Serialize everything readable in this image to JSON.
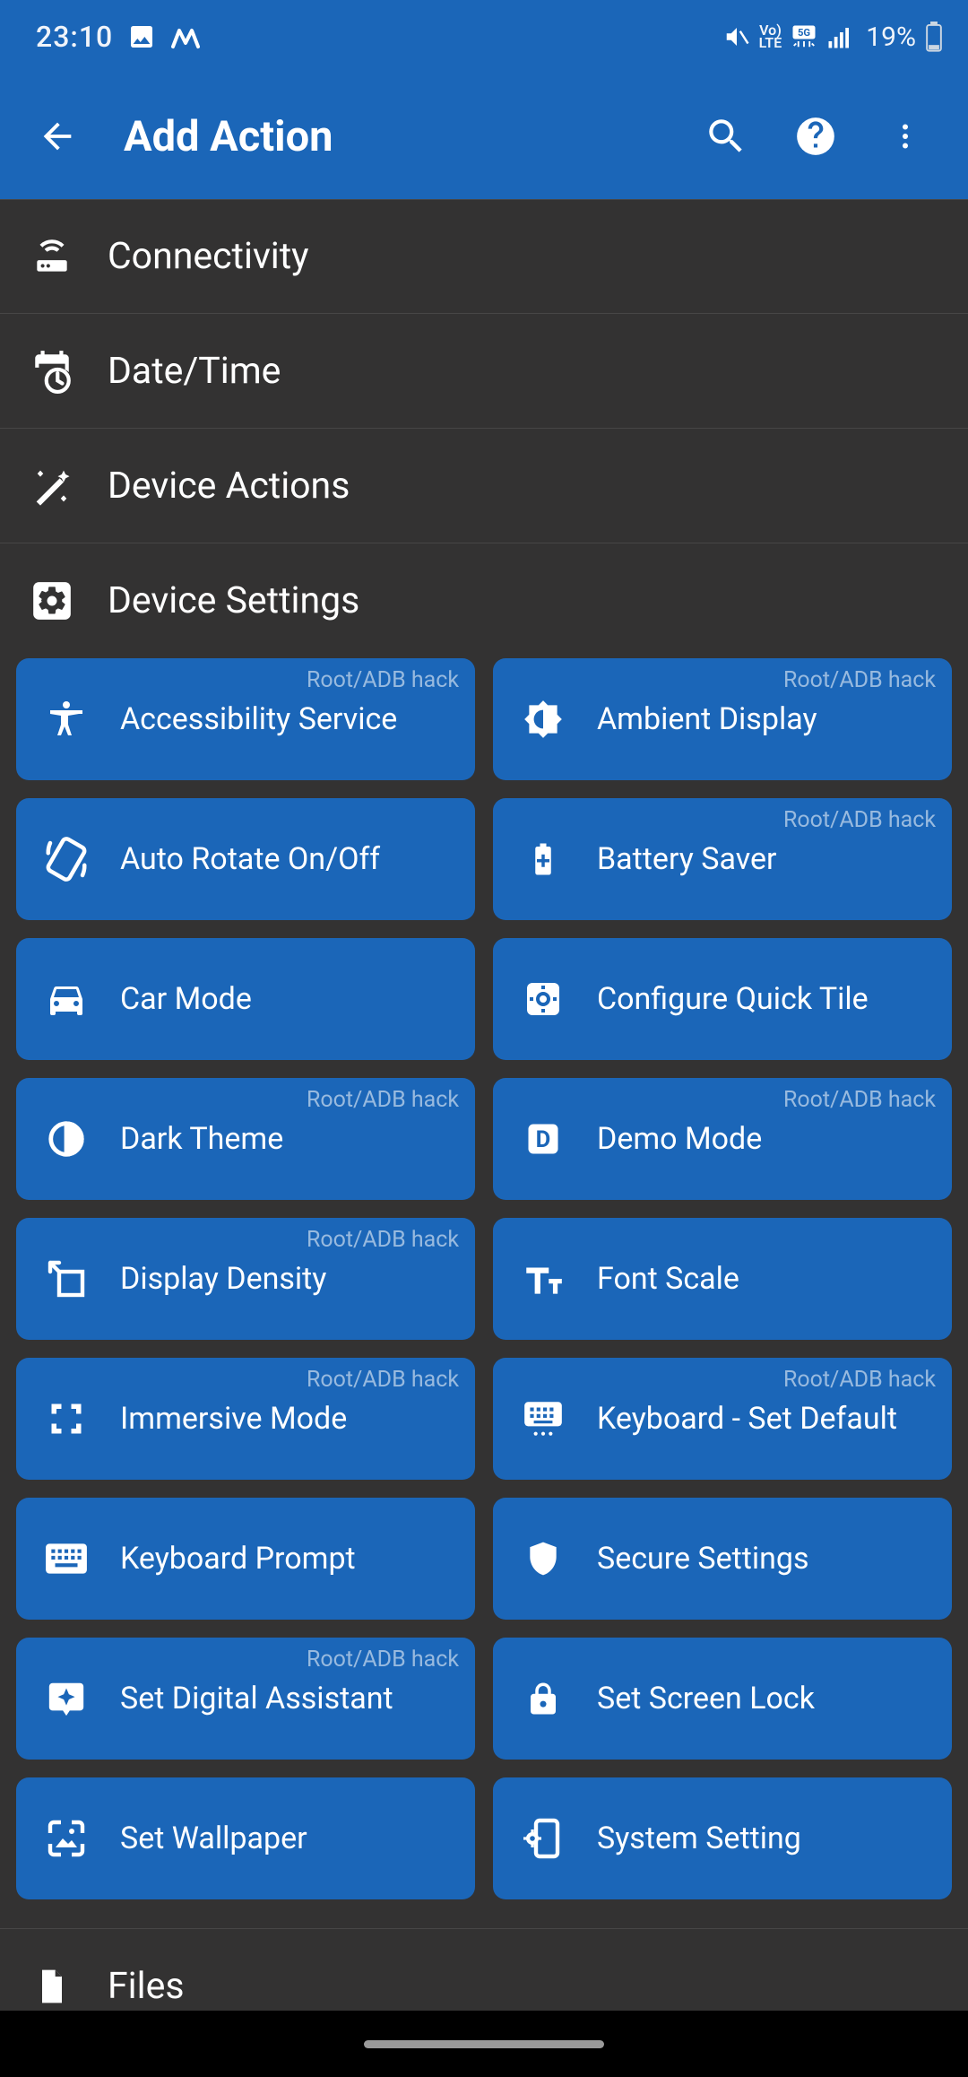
{
  "status": {
    "time": "23:10",
    "battery_text": "19%"
  },
  "appbar": {
    "title": "Add Action"
  },
  "badge_text": "Root/ADB hack",
  "categories": [
    {
      "id": "connectivity",
      "label": "Connectivity"
    },
    {
      "id": "datetime",
      "label": "Date/Time"
    },
    {
      "id": "device-actions",
      "label": "Device Actions"
    }
  ],
  "section": {
    "id": "device-settings",
    "label": "Device Settings"
  },
  "tiles": [
    {
      "id": "accessibility-service",
      "label": "Accessibility Service",
      "badge": true
    },
    {
      "id": "ambient-display",
      "label": "Ambient Display",
      "badge": true
    },
    {
      "id": "auto-rotate",
      "label": "Auto Rotate On/Off",
      "badge": false
    },
    {
      "id": "battery-saver",
      "label": "Battery Saver",
      "badge": true
    },
    {
      "id": "car-mode",
      "label": "Car Mode",
      "badge": false
    },
    {
      "id": "configure-quick-tile",
      "label": "Configure Quick Tile",
      "badge": false
    },
    {
      "id": "dark-theme",
      "label": "Dark Theme",
      "badge": true
    },
    {
      "id": "demo-mode",
      "label": "Demo Mode",
      "badge": true
    },
    {
      "id": "display-density",
      "label": "Display Density",
      "badge": true
    },
    {
      "id": "font-scale",
      "label": "Font Scale",
      "badge": false
    },
    {
      "id": "immersive-mode",
      "label": "Immersive Mode",
      "badge": true
    },
    {
      "id": "keyboard-set-default",
      "label": "Keyboard - Set Default",
      "badge": true
    },
    {
      "id": "keyboard-prompt",
      "label": "Keyboard Prompt",
      "badge": false
    },
    {
      "id": "secure-settings",
      "label": "Secure Settings",
      "badge": false
    },
    {
      "id": "set-digital-assistant",
      "label": "Set Digital Assistant",
      "badge": true
    },
    {
      "id": "set-screen-lock",
      "label": "Set Screen Lock",
      "badge": false
    },
    {
      "id": "set-wallpaper",
      "label": "Set Wallpaper",
      "badge": false
    },
    {
      "id": "system-setting",
      "label": "System Setting",
      "badge": false
    }
  ],
  "post_category": {
    "id": "files",
    "label": "Files"
  }
}
